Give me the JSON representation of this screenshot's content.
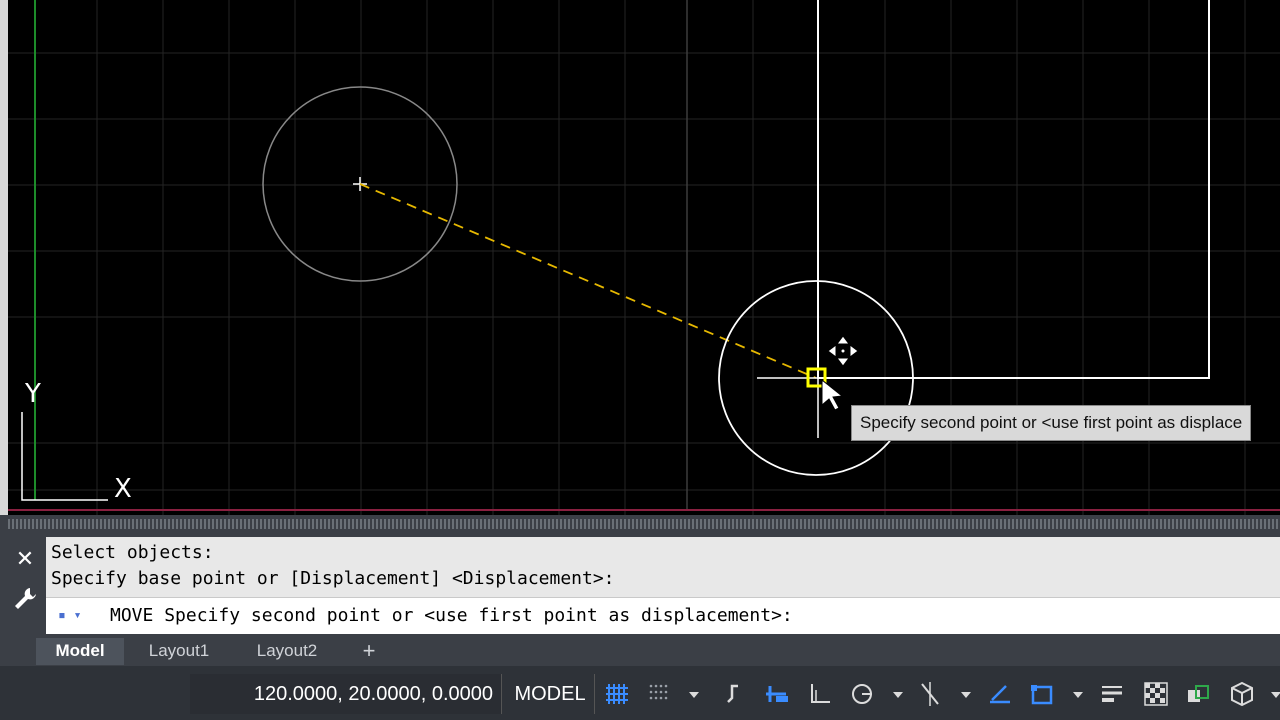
{
  "viewport": {
    "ucs_icon": {
      "y_label": "Y",
      "x_label": "X"
    },
    "tooltip": "Specify second point or <use first point as displace"
  },
  "command_line": {
    "history": [
      "Select objects:",
      "Specify base point or [Displacement] <Displacement>:"
    ],
    "input_prefix": "MOVE",
    "input_text": "Specify second point or <use first point as displacement>:",
    "close_icon": "close-icon",
    "settings_icon": "wrench-icon"
  },
  "tabs": {
    "items": [
      {
        "label": "Model",
        "active": true
      },
      {
        "label": "Layout1",
        "active": false
      },
      {
        "label": "Layout2",
        "active": false
      }
    ],
    "add_label": "+"
  },
  "status_bar": {
    "coordinates": "120.0000, 20.0000, 0.0000",
    "space": "MODEL",
    "icons": [
      "grid-icon",
      "snap-grid-icon",
      "dropdown-icon",
      "infer-constraints-icon",
      "dynamic-input-icon",
      "ortho-icon",
      "polar-tracking-icon",
      "dropdown-icon",
      "object-snap-tracking-icon",
      "dropdown-icon",
      "isodraft-icon",
      "annotation-monitor-icon",
      "dropdown-icon",
      "lineweight-icon",
      "transparency-icon",
      "selection-cycling-icon",
      "3d-osnap-icon"
    ]
  },
  "colors": {
    "viewport_bg": "#000000",
    "grid": "#2a2a2a",
    "rubber_band": "#e6b800",
    "grip": "#ffff00",
    "y_axis": "#1d8c2a"
  }
}
